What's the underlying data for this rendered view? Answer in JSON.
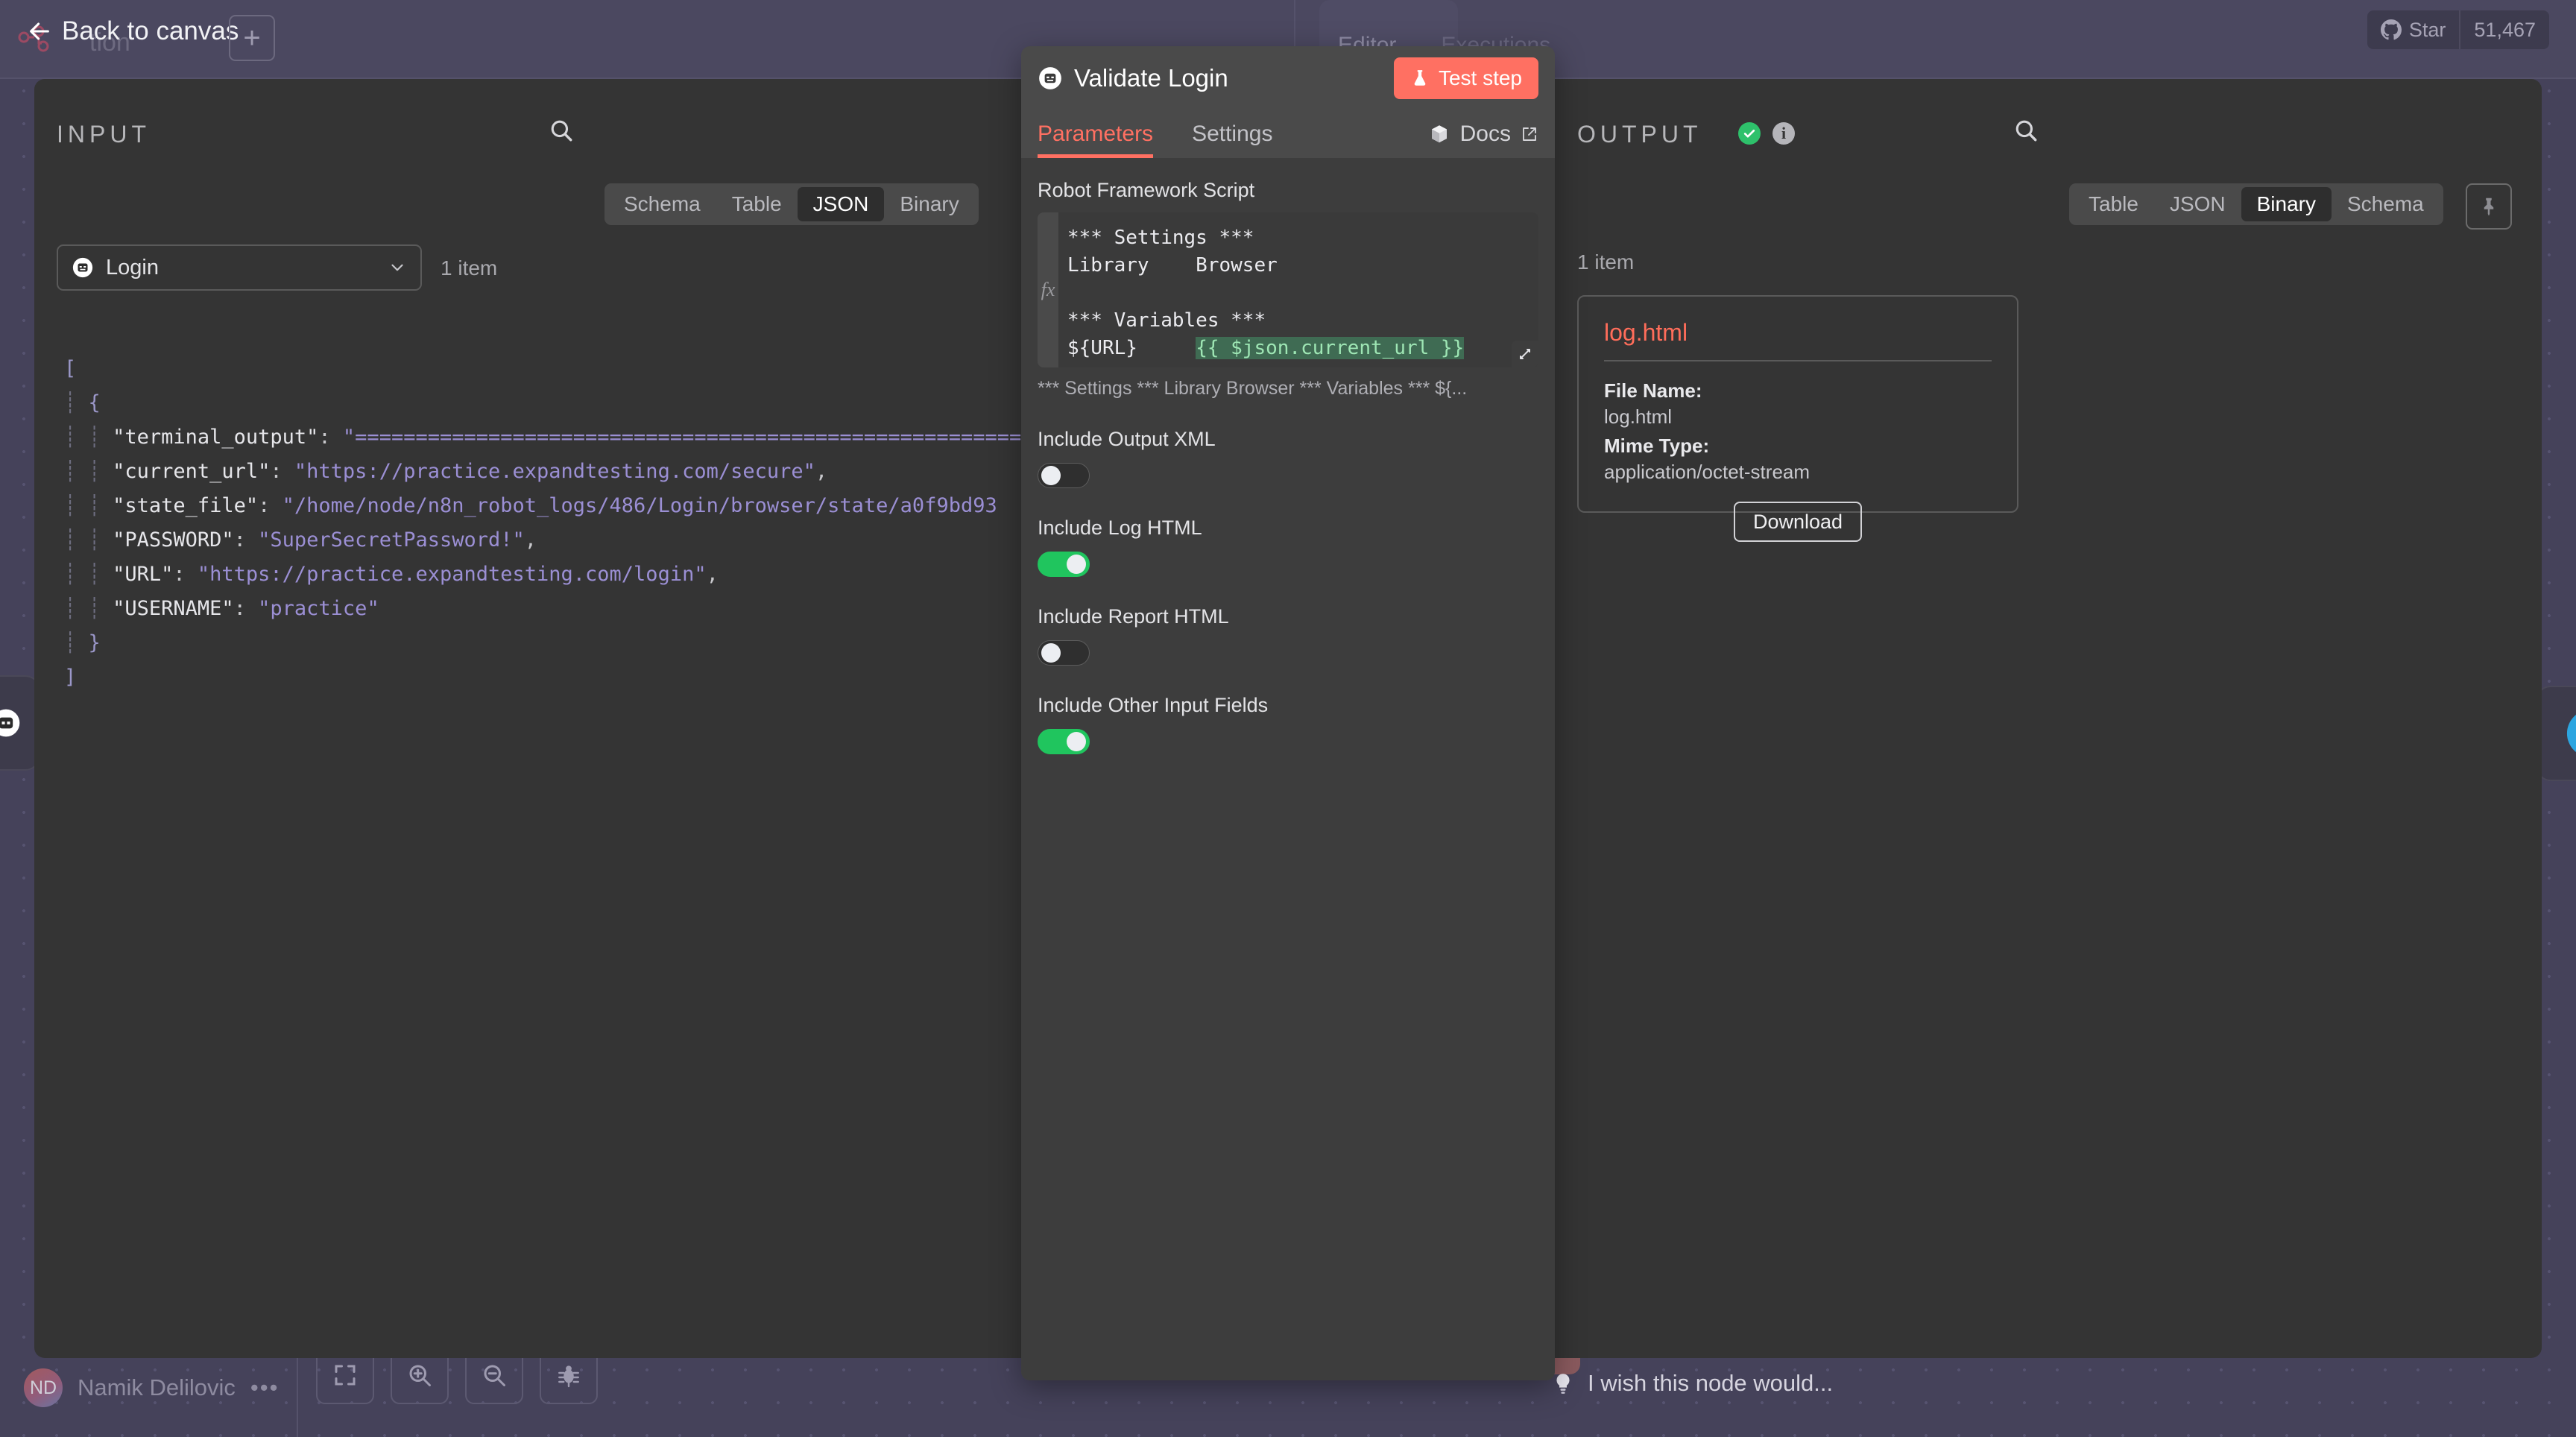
{
  "topbar": {
    "back_label": "Back to canvas",
    "add_button": "+",
    "workflow_name": "tion",
    "tabs": [
      {
        "label": "Editor",
        "active": true
      },
      {
        "label": "Executions",
        "active": false
      }
    ],
    "github": {
      "label": "Star",
      "count": "51,467",
      "icon": "github-icon"
    }
  },
  "input_panel": {
    "title": "INPUT",
    "search_icon": "search-icon",
    "view_tabs": [
      {
        "label": "Schema",
        "active": false
      },
      {
        "label": "Table",
        "active": false
      },
      {
        "label": "JSON",
        "active": true
      },
      {
        "label": "Binary",
        "active": false
      }
    ],
    "node_select": {
      "value": "Login",
      "icon": "robot-icon",
      "chevron": "chevron-down-icon"
    },
    "item_count": "1 item",
    "json_lines": [
      "[",
      "  {",
      "    \"terminal_output\": \"========================================================================",
      "    \"current_url\": \"https://practice.expandtesting.com/secure\",",
      "    \"state_file\": \"/home/node/n8n_robot_logs/486/Login/browser/state/a0f9bd93",
      "    \"PASSWORD\": \"SuperSecretPassword!\",",
      "    \"URL\": \"https://practice.expandtesting.com/login\",",
      "    \"USERNAME\": \"practice\"",
      "  }",
      "]"
    ],
    "json_fields": [
      {
        "key": "terminal_output",
        "value": "========================================================================"
      },
      {
        "key": "current_url",
        "value": "https://practice.expandtesting.com/secure"
      },
      {
        "key": "state_file",
        "value": "/home/node/n8n_robot_logs/486/Login/browser/state/a0f9bd93"
      },
      {
        "key": "PASSWORD",
        "value": "SuperSecretPassword!"
      },
      {
        "key": "URL",
        "value": "https://practice.expandtesting.com/login"
      },
      {
        "key": "USERNAME",
        "value": "practice"
      }
    ]
  },
  "node_dialog": {
    "icon": "robot-icon",
    "title": "Validate Login",
    "test_button": {
      "label": "Test step",
      "icon": "flask-icon"
    },
    "tabs": [
      {
        "label": "Parameters",
        "active": true
      },
      {
        "label": "Settings",
        "active": false
      }
    ],
    "docs": {
      "label": "Docs",
      "icon": "cube-icon",
      "external_icon": "external-link-icon"
    },
    "script_field": {
      "label": "Robot Framework Script",
      "fx_marker": "fx",
      "lines": [
        {
          "text": "*** Settings ***",
          "kind": "plain"
        },
        {
          "text": "Library    Browser",
          "kind": "plain"
        },
        {
          "text": "",
          "kind": "plain"
        },
        {
          "text": "*** Variables ***",
          "kind": "plain"
        },
        {
          "text": "${URL}     ",
          "kind": "plain",
          "resolved": "{{ $json.current_url }}"
        }
      ],
      "preview": "*** Settings *** Library   Browser *** Variables *** ${...",
      "expand_icon": "expand-icon"
    },
    "toggles": [
      {
        "label": "Include Output XML",
        "on": false
      },
      {
        "label": "Include Log HTML",
        "on": true
      },
      {
        "label": "Include Report HTML",
        "on": false
      },
      {
        "label": "Include Other Input Fields",
        "on": true
      }
    ]
  },
  "output_panel": {
    "title": "OUTPUT",
    "status_icon": "check-circle-icon",
    "info_icon": "info-icon",
    "search_icon": "search-icon",
    "view_tabs": [
      {
        "label": "Table",
        "active": false
      },
      {
        "label": "JSON",
        "active": false
      },
      {
        "label": "Binary",
        "active": true
      },
      {
        "label": "Schema",
        "active": false
      }
    ],
    "pin_icon": "pin-icon",
    "item_count": "1 item",
    "binary_card": {
      "name": "log.html",
      "file_name_label": "File Name:",
      "file_name_value": "log.html",
      "mime_label": "Mime Type:",
      "mime_value": "application/octet-stream",
      "download_label": "Download"
    }
  },
  "bottombar": {
    "user": {
      "initials": "ND",
      "name": "Namik Delilovic",
      "more": "•••"
    },
    "zoom_buttons": [
      {
        "icon": "fit-view-icon"
      },
      {
        "icon": "zoom-in-icon"
      },
      {
        "icon": "zoom-out-icon"
      },
      {
        "icon": "bug-icon"
      }
    ],
    "wish": {
      "icon": "lightbulb-icon",
      "text": "I wish this node would..."
    }
  },
  "colors": {
    "accent": "#ff7062",
    "toggle_on": "#20c55e",
    "status_ok": "#2ec16b",
    "dialog_bg": "#4a4a4a",
    "panel_bg": "#343434",
    "canvas_bg": "#45425a"
  }
}
